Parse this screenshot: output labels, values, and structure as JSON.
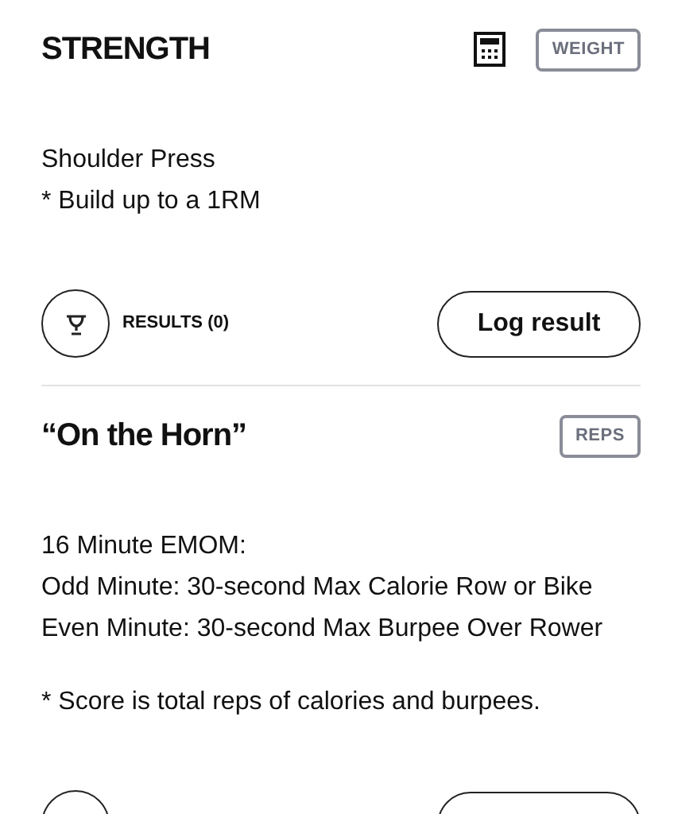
{
  "sections": [
    {
      "title": "STRENGTH",
      "header_icons": [
        {
          "kind": "calculator"
        }
      ],
      "tag": "WEIGHT",
      "paragraphs": [
        [
          "Shoulder Press",
          "* Build up to a 1RM"
        ]
      ],
      "results_label": "RESULTS (0)",
      "log_label": "Log result"
    },
    {
      "title": "“On the Horn”",
      "tag": "REPS",
      "paragraphs": [
        [
          "16 Minute EMOM:",
          "Odd Minute: 30-second Max Calorie Row or Bike",
          "Even Minute: 30-second Max Burpee Over Rower"
        ],
        [
          "* Score is total reps of calories and burpees."
        ]
      ]
    }
  ]
}
